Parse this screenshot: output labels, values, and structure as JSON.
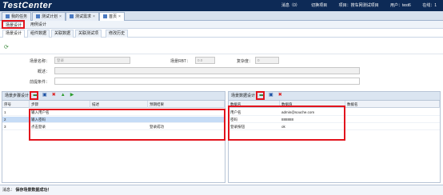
{
  "app": {
    "logo": "TestCenter",
    "nav": [
      "消息（0）",
      "切换项目",
      "项目：搜车网测试项目",
      "用户：test6",
      "在线：1"
    ]
  },
  "tabs": [
    {
      "label": "我的任务"
    },
    {
      "label": "测试计划"
    },
    {
      "label": "测试需求"
    },
    {
      "label": "首页"
    }
  ],
  "subtabs": {
    "scene_design": "场景设计",
    "case_design": "用例设计"
  },
  "subtabs2": [
    "场景设计",
    "组件数据",
    "关联数据",
    "关联测试项",
    "修改历史"
  ],
  "form": {
    "scene_name_label": "场景名称：",
    "scene_name_value": "登录",
    "scene_id_label": "场景RBT：",
    "scene_id_value": "0.0",
    "reuse_label": "复杂度：",
    "reuse_value": "0",
    "desc_label": "概述：",
    "precond_label": "前提条件："
  },
  "steps_panel": {
    "title": "场景步骤设计",
    "columns": [
      "序号",
      "步骤",
      "描述",
      "预期结果"
    ],
    "rows": [
      {
        "no": "1",
        "step": "输入用户名",
        "desc": "",
        "expected": ""
      },
      {
        "no": "2",
        "step": "输入密码",
        "desc": "",
        "expected": ""
      },
      {
        "no": "3",
        "step": "点击登录",
        "desc": "",
        "expected": "登录成功"
      }
    ]
  },
  "data_panel": {
    "title": "场景数据设计",
    "columns": [
      "数据名",
      "数据值",
      "数据名"
    ],
    "rows": [
      {
        "name": "用户名",
        "value": "admin@souche.com"
      },
      {
        "name": "密码",
        "value": "888888"
      },
      {
        "name": "登录按钮",
        "value": "ok"
      }
    ]
  },
  "status": {
    "label": "消息：",
    "message": "保存场景数据成功！"
  },
  "colors": {
    "topbar": "#0d2a56",
    "highlight": "#e2141d",
    "selected_row": "#c6dcf6"
  }
}
